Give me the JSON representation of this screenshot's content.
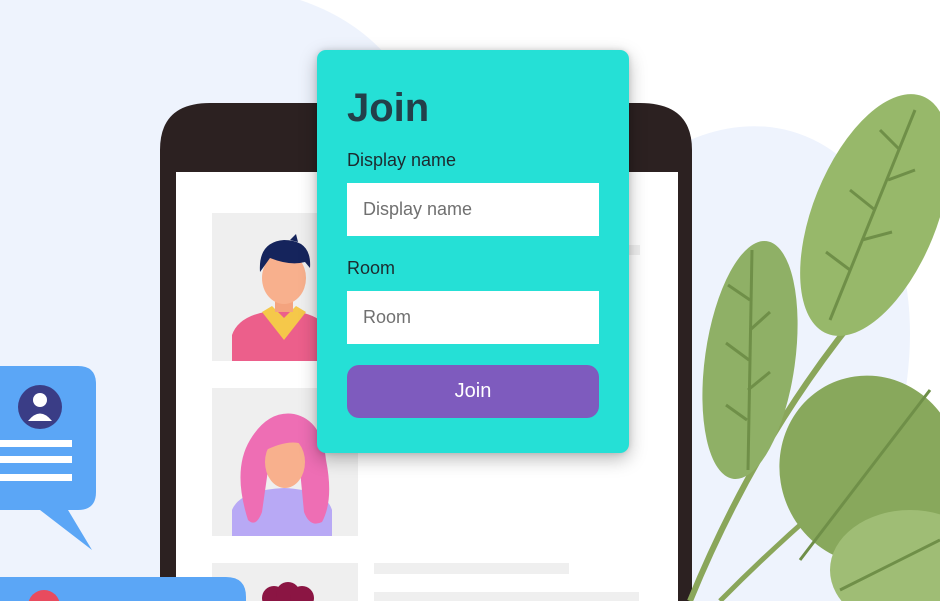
{
  "join_form": {
    "title": "Join",
    "display_name_label": "Display name",
    "display_name_placeholder": "Display name",
    "display_name_value": "",
    "room_label": "Room",
    "room_placeholder": "Room",
    "room_value": "",
    "join_button_label": "Join"
  },
  "colors": {
    "card_background": "#25e0d6",
    "title_text": "#23404a",
    "button_background": "#7e5bbe",
    "button_text": "#ffffff",
    "input_background": "#ffffff"
  },
  "illustration": {
    "icons": [
      "phone-frame",
      "male-avatar-icon",
      "female-avatar-icon",
      "chat-bubble-icon",
      "user-icon",
      "leaf-plant"
    ]
  }
}
